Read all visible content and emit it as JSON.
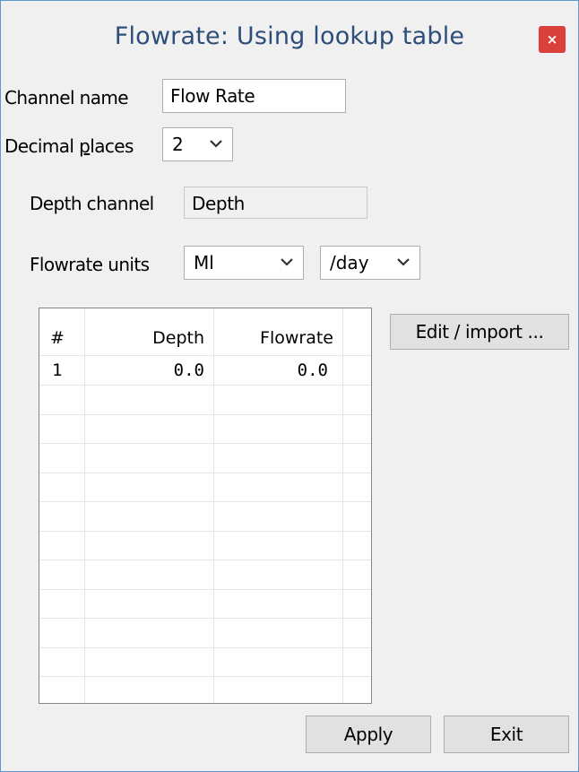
{
  "window": {
    "title": "Flowrate: Using lookup table",
    "close_glyph": "×"
  },
  "form": {
    "channel_name_label": "Channel name",
    "channel_name_value": "Flow Rate",
    "decimal_places_label_pre": "Decimal ",
    "decimal_places_label_accel": "p",
    "decimal_places_label_post": "laces",
    "decimal_places_value": "2",
    "depth_channel_label": "Depth channel",
    "depth_channel_value": "Depth",
    "flowrate_units_label": "Flowrate units",
    "flowrate_unit_value": "Ml",
    "flowrate_period_value": "/day"
  },
  "table": {
    "columns": [
      "#",
      "Depth",
      "Flowrate"
    ],
    "rows": [
      {
        "index": "1",
        "depth": "0.0",
        "flowrate": "0.0"
      }
    ]
  },
  "buttons": {
    "edit_import": "Edit / import ...",
    "apply": "Apply",
    "exit": "Exit"
  },
  "icons": {
    "close": "close-icon",
    "dropdown": "chevron-down-icon"
  }
}
